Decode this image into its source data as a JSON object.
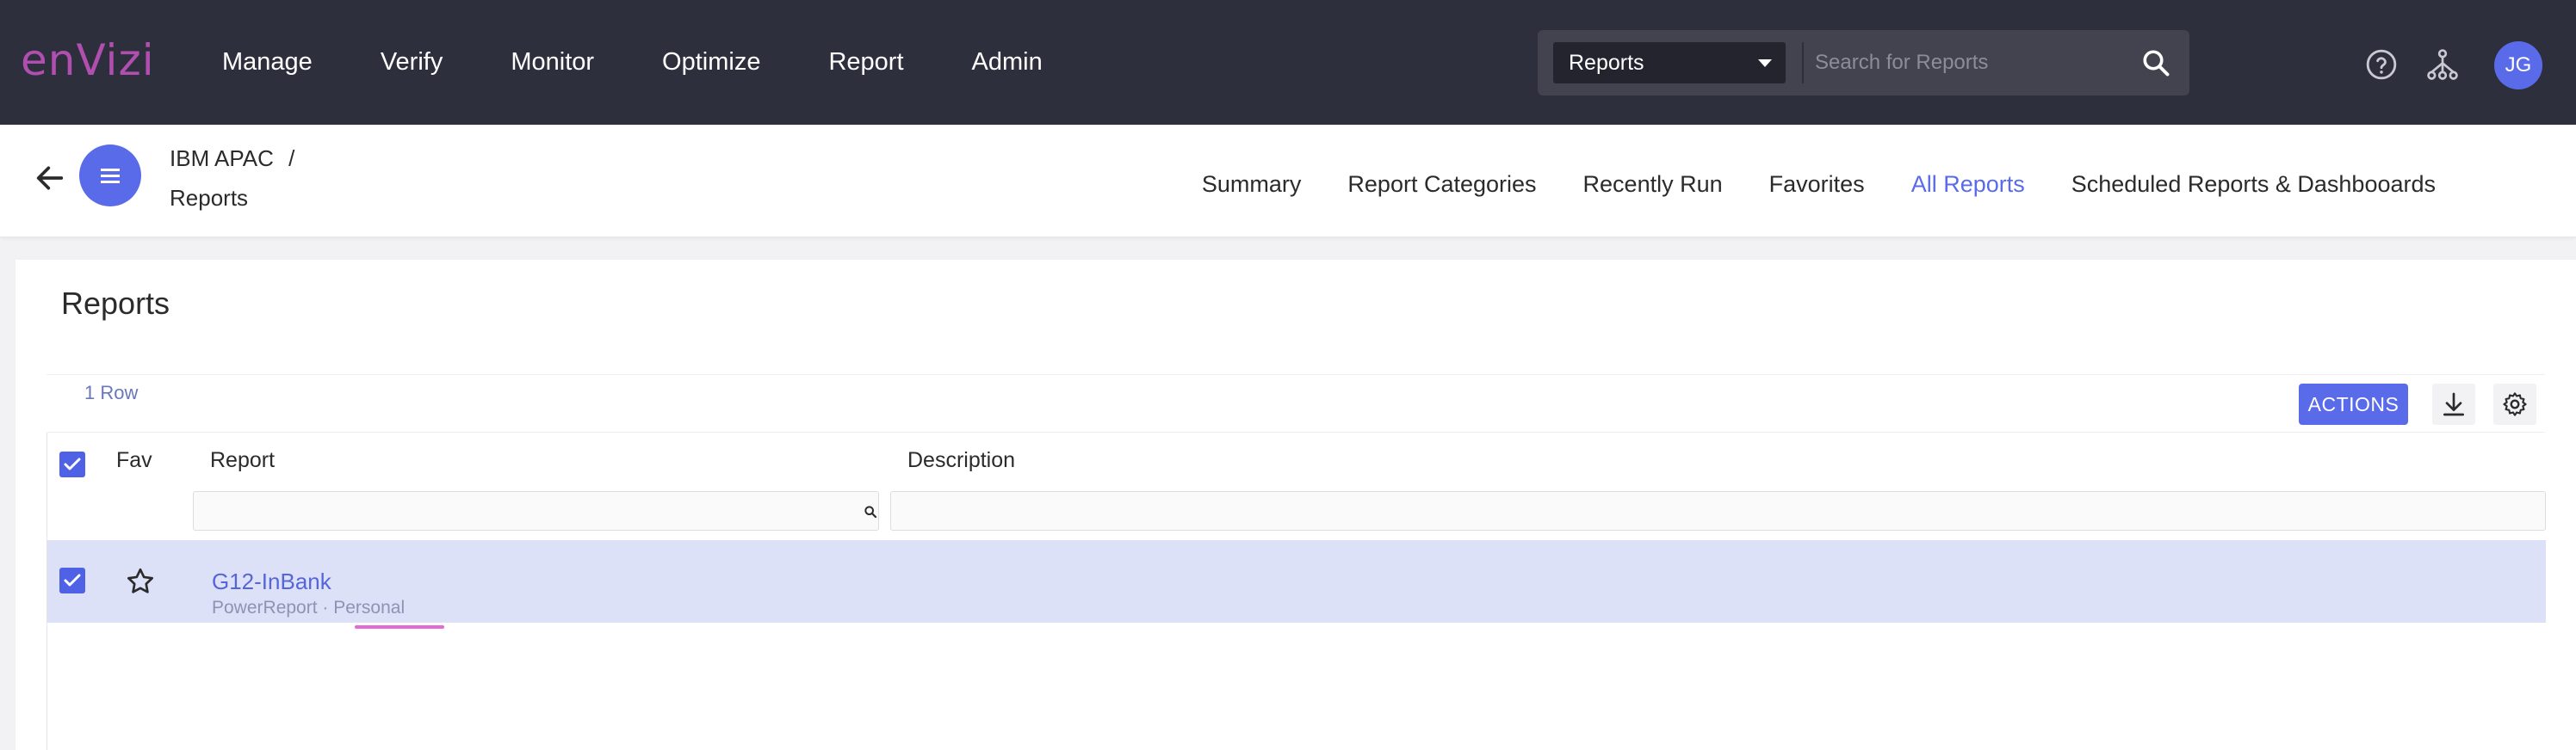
{
  "brand": {
    "logo_text": "enVizi",
    "color": "#b04fb0"
  },
  "nav": {
    "items": [
      "Manage",
      "Verify",
      "Monitor",
      "Optimize",
      "Report",
      "Admin"
    ]
  },
  "search": {
    "scope": "Reports",
    "placeholder": "Search for Reports",
    "icon": "search-icon"
  },
  "header_icons": [
    "help-icon",
    "hierarchy-icon"
  ],
  "user": {
    "initials": "JG"
  },
  "breadcrumb": {
    "org": "IBM APAC",
    "separator": "/",
    "page": "Reports"
  },
  "tabs": {
    "items": [
      "Summary",
      "Report Categories",
      "Recently Run",
      "Favorites",
      "All Reports",
      "Scheduled Reports & Dashbooards"
    ],
    "active": "All Reports"
  },
  "reports": {
    "title": "Reports",
    "row_count": "1 Row",
    "actions_label": "ACTIONS",
    "columns": {
      "select": "",
      "fav": "Fav",
      "report": "Report",
      "description": "Description"
    },
    "rows": [
      {
        "name": "G12-InBank",
        "type": "PowerReport",
        "separator": "·",
        "scope": "Personal",
        "description": "",
        "selected": true,
        "favorite": false
      }
    ]
  },
  "colors": {
    "accent": "#5a6bea",
    "topbar": "#2e2f3c",
    "row_selected": "#dde1f8",
    "highlight": "#e46ad6"
  }
}
